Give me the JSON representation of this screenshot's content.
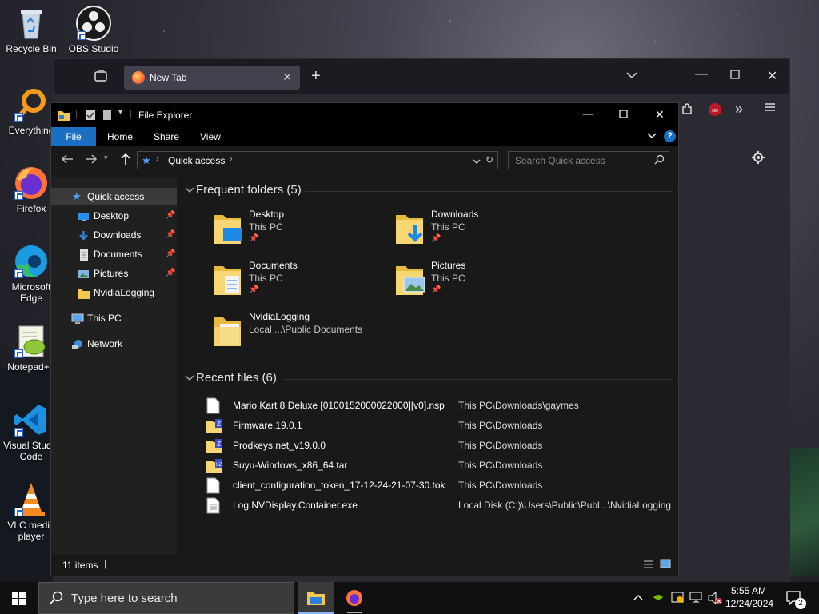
{
  "desktop": {
    "icons": [
      {
        "label": "Recycle Bin",
        "icon": "recycle-bin-icon"
      },
      {
        "label": "OBS Studio",
        "icon": "obs-icon"
      },
      {
        "label": "Everything",
        "icon": "everything-icon"
      },
      {
        "label": "Firefox",
        "icon": "firefox-icon"
      },
      {
        "label": "Microsoft Edge",
        "icon": "edge-icon"
      },
      {
        "label": "Notepad++",
        "icon": "notepadpp-icon"
      },
      {
        "label": "Visual Studio Code",
        "icon": "vscode-icon"
      },
      {
        "label": "VLC media player",
        "icon": "vlc-icon"
      }
    ]
  },
  "firefox": {
    "tab_title": "New Tab"
  },
  "explorer": {
    "title": "File Explorer",
    "ribbon_tabs": [
      "File",
      "Home",
      "Share",
      "View"
    ],
    "breadcrumb": "Quick access",
    "search_placeholder": "Search Quick access",
    "nav": [
      {
        "label": "Quick access",
        "pinned": false
      },
      {
        "label": "Desktop",
        "pinned": true
      },
      {
        "label": "Downloads",
        "pinned": true
      },
      {
        "label": "Documents",
        "pinned": true
      },
      {
        "label": "Pictures",
        "pinned": true
      },
      {
        "label": "NvidiaLogging",
        "pinned": false
      },
      {
        "label": "This PC",
        "pinned": false
      },
      {
        "label": "Network",
        "pinned": false
      }
    ],
    "frequent_header": "Frequent folders (5)",
    "folders": [
      {
        "name": "Desktop",
        "location": "This PC"
      },
      {
        "name": "Downloads",
        "location": "This PC"
      },
      {
        "name": "Documents",
        "location": "This PC"
      },
      {
        "name": "Pictures",
        "location": "This PC"
      },
      {
        "name": "NvidiaLogging",
        "location": "Local ...\\Public Documents"
      }
    ],
    "recent_header": "Recent files (6)",
    "recent": [
      {
        "name": "Mario Kart 8 Deluxe [0100152000022000][v0].nsp",
        "path": "This PC\\Downloads\\gaymes"
      },
      {
        "name": "Firmware.19.0.1",
        "path": "This PC\\Downloads"
      },
      {
        "name": "Prodkeys.net_v19.0.0",
        "path": "This PC\\Downloads"
      },
      {
        "name": "Suyu-Windows_x86_64.tar",
        "path": "This PC\\Downloads"
      },
      {
        "name": "client_configuration_token_17-12-24-21-07-30.tok",
        "path": "This PC\\Downloads"
      },
      {
        "name": "Log.NVDisplay.Container.exe",
        "path": "Local Disk (C:)\\Users\\Public\\Publ...\\NvidiaLogging"
      }
    ],
    "status_items": "11 items"
  },
  "taskbar": {
    "search_placeholder": "Type here to search",
    "time": "5:55 AM",
    "date": "12/24/2024",
    "notification_count": "2"
  }
}
